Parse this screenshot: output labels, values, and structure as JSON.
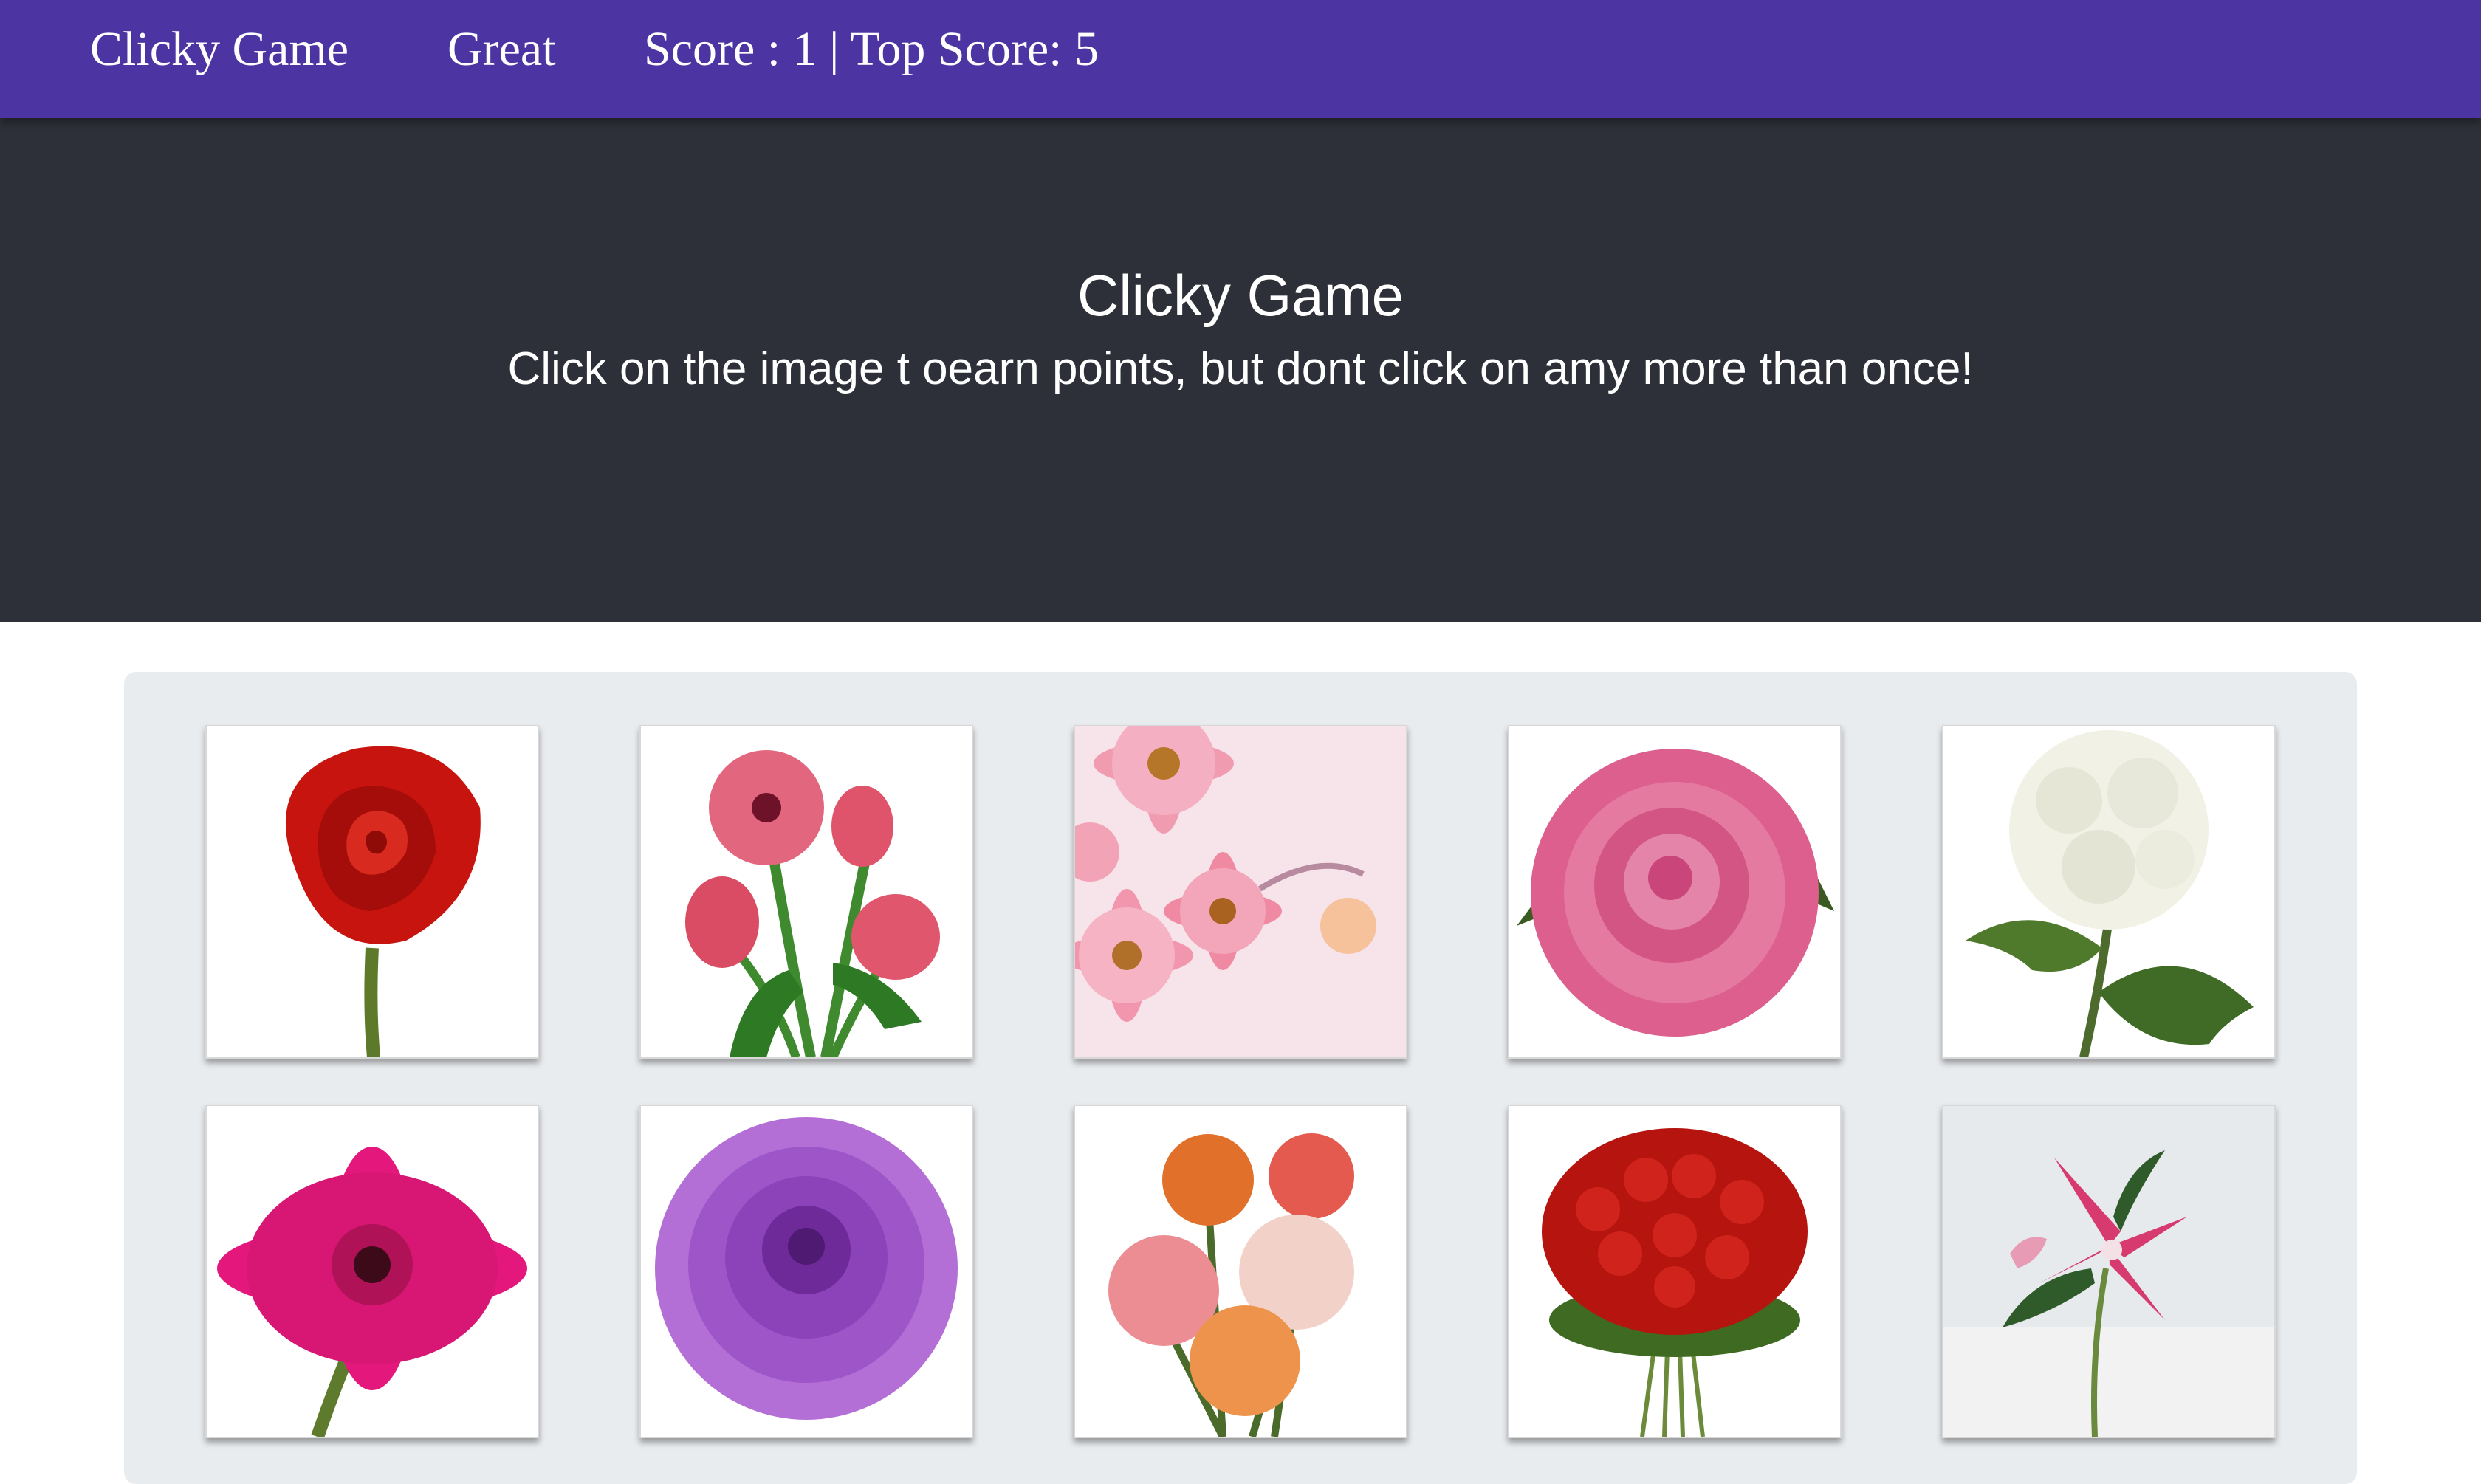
{
  "navbar": {
    "brand": "Clicky Game",
    "status": "Great",
    "score": "Score : 1 | Top Score: 5"
  },
  "header": {
    "title": "Clicky Game",
    "subtitle": "Click on the image t oearn points, but dont click on amy more than once!"
  },
  "colors": {
    "navbar": "#4c35a2",
    "jumbotron": "#2d3038",
    "board": "#e9ecef"
  },
  "cards": [
    {
      "icon": "red-rose-icon"
    },
    {
      "icon": "pink-tulips-icon"
    },
    {
      "icon": "pink-daisies-icon"
    },
    {
      "icon": "pink-rose-icon"
    },
    {
      "icon": "white-hydrangea-icon"
    },
    {
      "icon": "pink-gerbera-icon"
    },
    {
      "icon": "purple-dahlia-icon"
    },
    {
      "icon": "mixed-roses-bouquet-icon"
    },
    {
      "icon": "red-roses-bouquet-icon"
    },
    {
      "icon": "stargazer-lily-icon"
    }
  ]
}
